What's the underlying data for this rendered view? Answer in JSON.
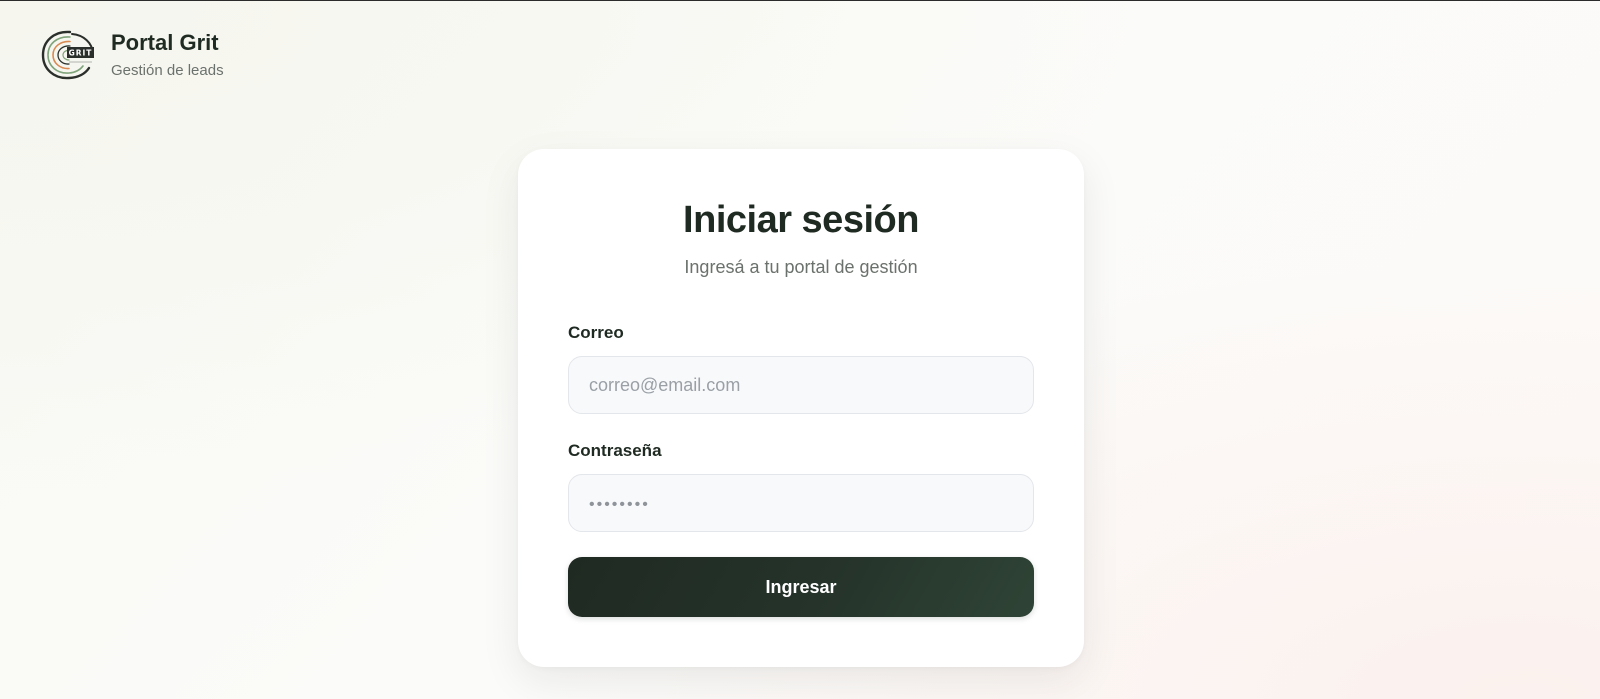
{
  "brand": {
    "logo_icon": "grit-tree-rings-logo-icon",
    "logo_text": "GRIT",
    "title": "Portal Grit",
    "subtitle": "Gestión de leads"
  },
  "login": {
    "title": "Iniciar sesión",
    "subtitle": "Ingresá a tu portal de gestión",
    "email_label": "Correo",
    "email_placeholder": "correo@email.com",
    "email_value": "",
    "password_label": "Contraseña",
    "password_placeholder": "••••••••",
    "password_value": "",
    "submit_label": "Ingresar"
  },
  "colors": {
    "primary_dark": "#1f2a22",
    "muted_text": "#6b716c",
    "input_bg": "#f8f9fb",
    "input_border": "#e3e6ea",
    "logo_accent_orange": "#d98a52",
    "logo_accent_green": "#7fa37a"
  }
}
